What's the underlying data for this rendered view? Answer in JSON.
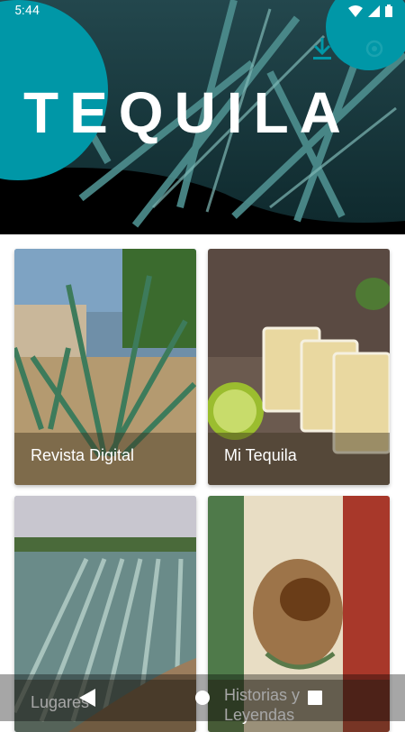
{
  "status_bar": {
    "time": "5:44"
  },
  "header": {
    "title": "TEQUILA",
    "brand_color": "#0097a7"
  },
  "cards": [
    {
      "label": "Revista Digital"
    },
    {
      "label": "Mi Tequila"
    },
    {
      "label": "Lugares"
    },
    {
      "label": "Historias y\nLeyendas"
    }
  ],
  "icons": {
    "download": "download-icon",
    "settings": "gear-icon",
    "back": "back-triangle-icon",
    "home": "home-circle-icon",
    "recent": "recent-square-icon"
  }
}
